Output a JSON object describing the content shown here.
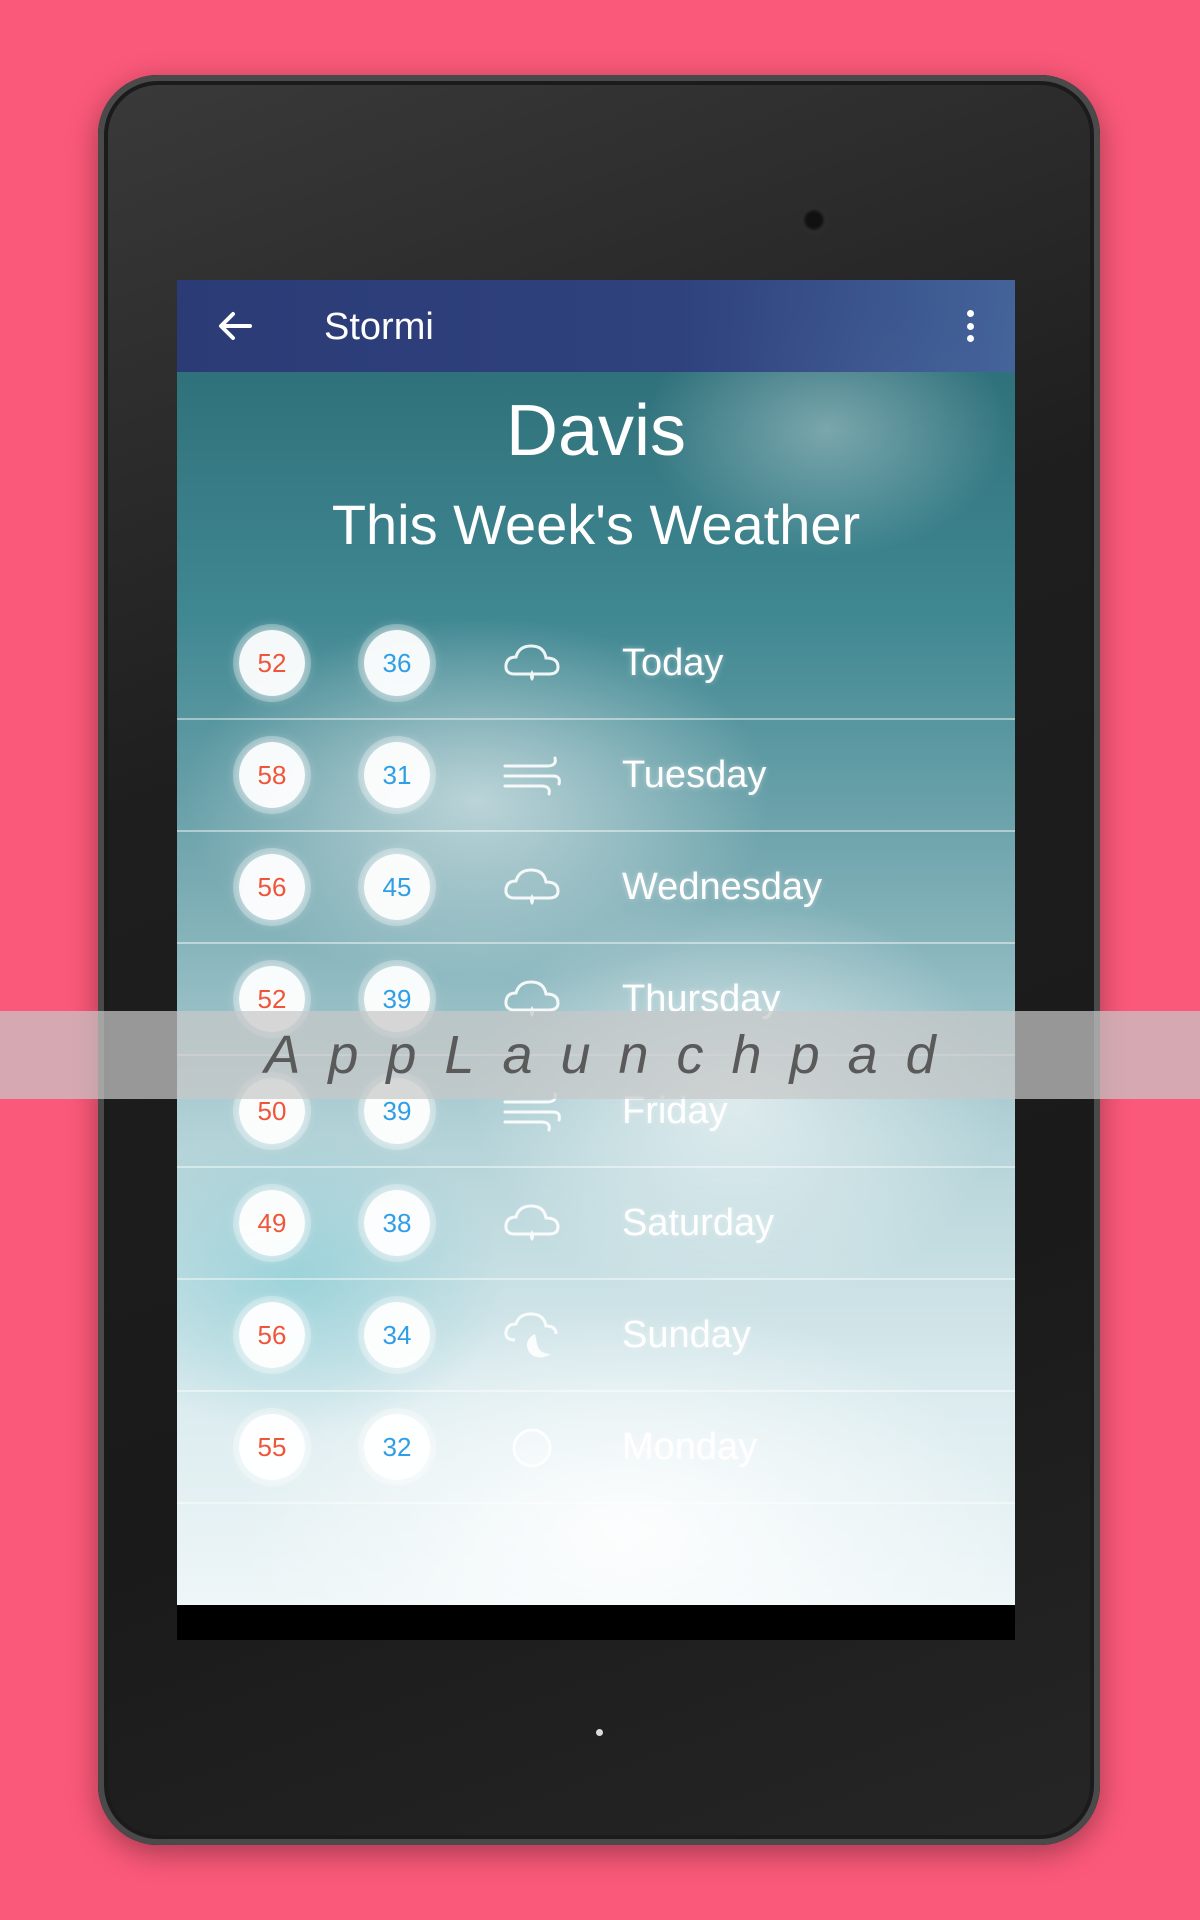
{
  "app_bar": {
    "title": "Stormi",
    "back_icon": "arrow-left-icon",
    "menu_icon": "more-vert-icon"
  },
  "header": {
    "city": "Davis",
    "subtitle": "This Week's Weather"
  },
  "forecast": [
    {
      "high": "52",
      "low": "36",
      "icon": "cloud-rain-icon",
      "day": "Today"
    },
    {
      "high": "58",
      "low": "31",
      "icon": "wind-icon",
      "day": "Tuesday"
    },
    {
      "high": "56",
      "low": "45",
      "icon": "cloud-rain-icon",
      "day": "Wednesday"
    },
    {
      "high": "52",
      "low": "39",
      "icon": "cloud-rain-icon",
      "day": "Thursday"
    },
    {
      "high": "50",
      "low": "39",
      "icon": "wind-icon",
      "day": "Friday"
    },
    {
      "high": "49",
      "low": "38",
      "icon": "cloud-rain-icon",
      "day": "Saturday"
    },
    {
      "high": "56",
      "low": "34",
      "icon": "cloud-night-icon",
      "day": "Sunday"
    },
    {
      "high": "55",
      "low": "32",
      "icon": "clear-circle-icon",
      "day": "Monday"
    }
  ],
  "watermark": "AppLaunchpad",
  "colors": {
    "background": "#fb5979",
    "appbar": "#2f427e",
    "high_temp": "#f0553a",
    "low_temp": "#2f9ee6"
  }
}
